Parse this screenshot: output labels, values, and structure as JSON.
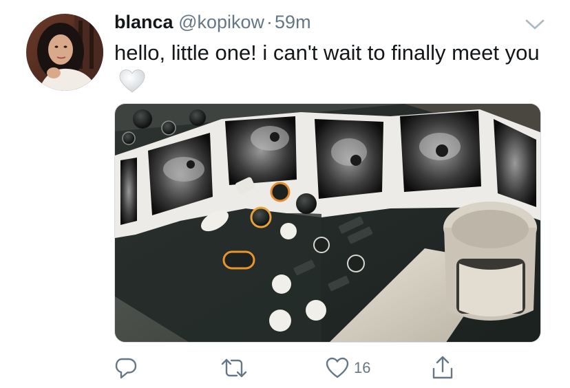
{
  "tweet": {
    "display_name": "blanca",
    "handle": "@kopikow",
    "separator": "·",
    "time": "59m",
    "text": "hello, little one! i can't wait to finally meet you",
    "emoji": "white-heart"
  },
  "actions": {
    "like_count": "16"
  },
  "icons": {
    "avatar": "profile-photo",
    "menu": "chevron-down-icon",
    "reply": "reply-icon",
    "retweet": "retweet-icon",
    "like": "heart-icon",
    "share": "share-icon"
  },
  "colors": {
    "text": "#14171a",
    "secondary": "#657786",
    "background": "#ffffff"
  }
}
